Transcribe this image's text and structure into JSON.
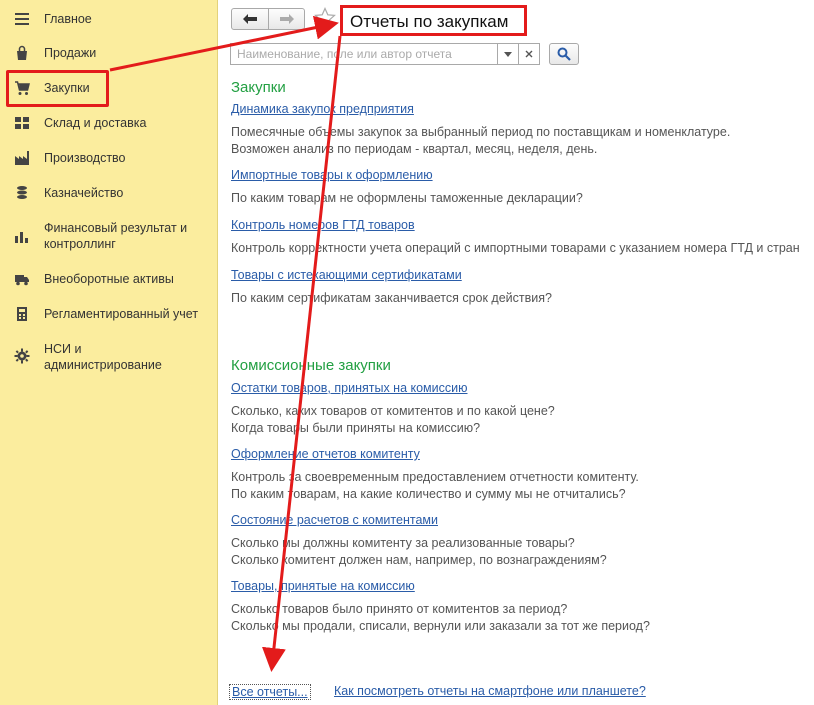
{
  "sidebar": {
    "items": [
      {
        "label": "Главное",
        "icon": "menu-icon"
      },
      {
        "label": "Продажи",
        "icon": "bag-icon"
      },
      {
        "label": "Закупки",
        "icon": "cart-icon"
      },
      {
        "label": "Склад и доставка",
        "icon": "warehouse-icon"
      },
      {
        "label": "Производство",
        "icon": "factory-icon"
      },
      {
        "label": "Казначейство",
        "icon": "coins-icon"
      },
      {
        "label": "Финансовый результат и",
        "label2": "контроллинг",
        "icon": "bar-chart-icon"
      },
      {
        "label": "Внеоборотные активы",
        "icon": "truck-icon"
      },
      {
        "label": "Регламентированный учет",
        "icon": "calculator-icon"
      },
      {
        "label": "НСИ и",
        "label2": "администрирование",
        "icon": "gear-icon"
      }
    ],
    "active_index": 2
  },
  "toolbar": {
    "title": "Отчеты по закупкам",
    "back_icon": "arrow-left-icon",
    "forward_icon": "arrow-right-icon",
    "favorite_icon": "star-icon"
  },
  "search": {
    "placeholder": "Наименование, поле или автор отчета",
    "value": ""
  },
  "sections": [
    {
      "title": "Закупки",
      "reports": [
        {
          "name": "Динамика закупок предприятия",
          "desc": [
            "Помесячные объемы закупок за выбранный период по поставщикам и номенклатуре.",
            "Возможен анализ по периодам - квартал, месяц, неделя, день."
          ]
        },
        {
          "name": "Импортные товары к оформлению",
          "desc": [
            "По каким товарам не оформлены таможенные декларации?"
          ]
        },
        {
          "name": "Контроль номеров ГТД товаров",
          "desc": [
            "Контроль корректности учета операций с импортными товарами с указанием номера ГТД и стран"
          ]
        },
        {
          "name": "Товары с истекающими сертификатами",
          "desc": [
            "По каким сертификатам заканчивается срок действия?"
          ]
        }
      ]
    },
    {
      "title": "Комиссионные закупки",
      "reports": [
        {
          "name": "Остатки товаров, принятых на комиссию",
          "desc": [
            "Сколько, каких товаров от комитентов и по какой цене?",
            "Когда товары были приняты на комиссию?"
          ]
        },
        {
          "name": "Оформление отчетов комитенту",
          "desc": [
            "Контроль за своевременным предоставлением отчетности комитенту.",
            "По каким товарам, на какие количество и сумму мы не отчитались?"
          ]
        },
        {
          "name": "Состояние расчетов с комитентами",
          "desc": [
            "Сколько мы должны комитенту за реализованные товары?",
            "Сколько комитент должен нам, например, по вознаграждениям?"
          ]
        },
        {
          "name": "Товары, принятые на комиссию",
          "desc": [
            "Сколько товаров было принято от комитентов за период?",
            "Сколько мы продали, списали, вернули или заказали за тот же период?"
          ]
        }
      ]
    }
  ],
  "footer": {
    "all_reports": "Все отчеты...",
    "mobile": "Как посмотреть отчеты на смартфоне или планшете?"
  },
  "colors": {
    "sidebar_bg": "#fbed9e",
    "highlight": "#e31b1b",
    "section_title": "#23a043",
    "link": "#2a5ca8"
  }
}
